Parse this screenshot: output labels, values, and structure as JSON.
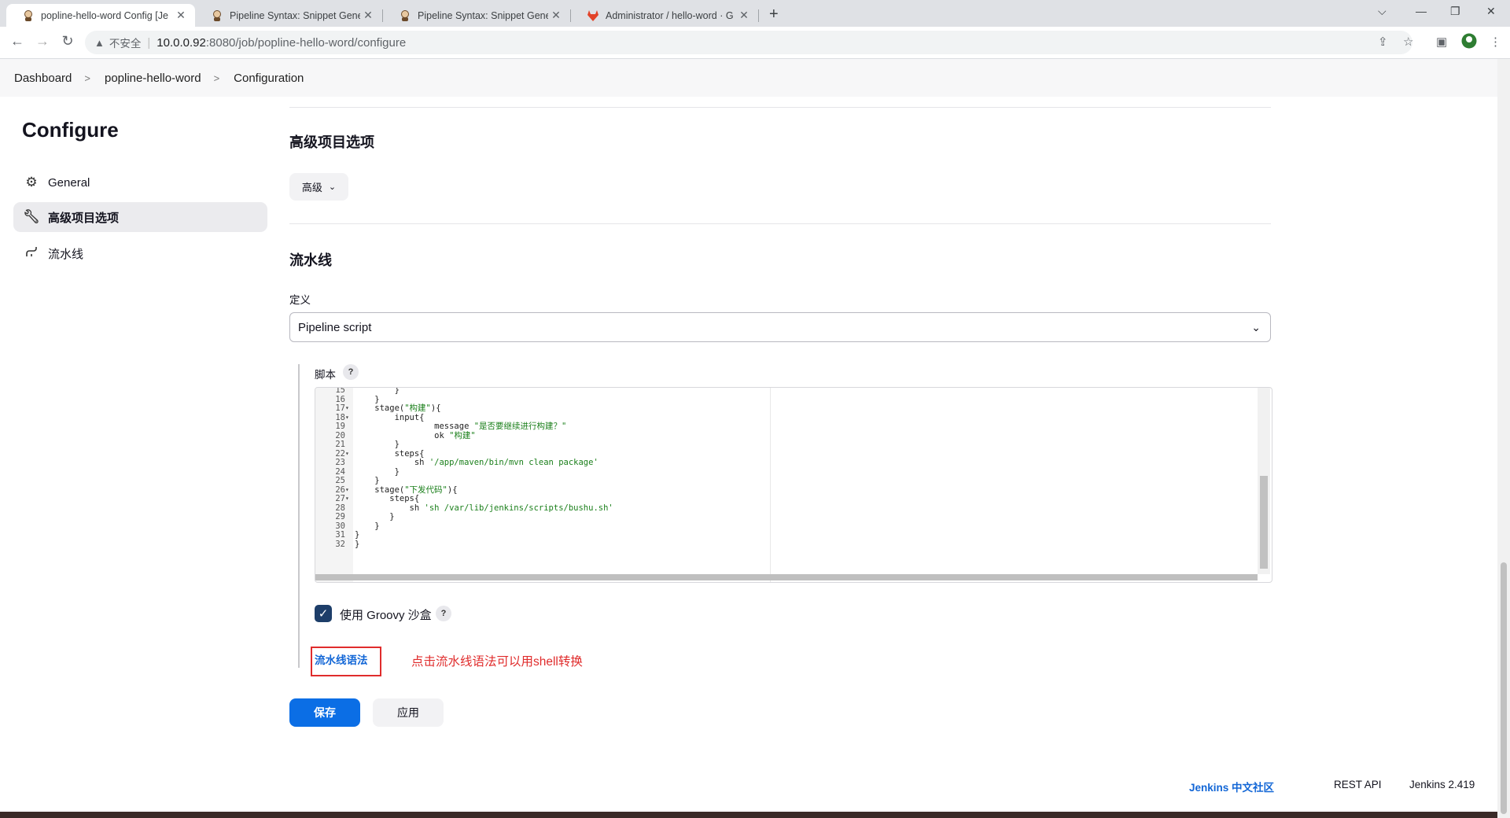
{
  "browser": {
    "tabs": [
      {
        "title": "popline-hello-word Config [Je",
        "active": true
      },
      {
        "title": "Pipeline Syntax: Snippet Gener",
        "active": false
      },
      {
        "title": "Pipeline Syntax: Snippet Gener",
        "active": false
      },
      {
        "title": "Administrator / hello-word · G",
        "active": false
      }
    ],
    "new_tab": "+",
    "window_controls": {
      "dropdown": "⌵",
      "minimize": "—",
      "restore": "❐",
      "close": "✕"
    },
    "address": {
      "warning_icon": "warning-icon",
      "insecure_label": "不安全",
      "host": "10.0.0.92",
      "path": ":8080/job/popline-hello-word/configure"
    }
  },
  "breadcrumb": [
    "Dashboard",
    "popline-hello-word",
    "Configuration"
  ],
  "sidebar": {
    "title": "Configure",
    "items": [
      {
        "label": "General",
        "icon": "gear-icon",
        "active": false
      },
      {
        "label": "高级项目选项",
        "icon": "wrench-icon",
        "active": true
      },
      {
        "label": "流水线",
        "icon": "pipeline-icon",
        "active": false
      }
    ]
  },
  "advanced": {
    "heading": "高级项目选项",
    "button_label": "高级"
  },
  "pipeline": {
    "heading": "流水线",
    "definition_label": "定义",
    "definition_value": "Pipeline script",
    "script_label": "脚本",
    "help": "?",
    "code_lines": [
      {
        "n": "15",
        "fold": "",
        "text": "        }"
      },
      {
        "n": "16",
        "fold": "",
        "text": "    }"
      },
      {
        "n": "17",
        "fold": "▾",
        "text": "    stage(\"构建\"){"
      },
      {
        "n": "18",
        "fold": "▾",
        "text": "        input{"
      },
      {
        "n": "19",
        "fold": "",
        "text": "                message \"是否要继续进行构建？\""
      },
      {
        "n": "20",
        "fold": "",
        "text": "                ok \"构建\""
      },
      {
        "n": "21",
        "fold": "",
        "text": "        }"
      },
      {
        "n": "22",
        "fold": "▾",
        "text": "        steps{"
      },
      {
        "n": "23",
        "fold": "",
        "text": "            sh '/app/maven/bin/mvn clean package'"
      },
      {
        "n": "24",
        "fold": "",
        "text": "        }"
      },
      {
        "n": "25",
        "fold": "",
        "text": "    }"
      },
      {
        "n": "26",
        "fold": "▾",
        "text": "    stage(\"下发代码\"){"
      },
      {
        "n": "27",
        "fold": "▾",
        "text": "       steps{"
      },
      {
        "n": "28",
        "fold": "",
        "text": "           sh 'sh /var/lib/jenkins/scripts/bushu.sh'"
      },
      {
        "n": "29",
        "fold": "",
        "text": "       }"
      },
      {
        "n": "30",
        "fold": "",
        "text": "    }"
      },
      {
        "n": "31",
        "fold": "",
        "text": "}"
      },
      {
        "n": "32",
        "fold": "",
        "text": "}"
      }
    ],
    "sandbox_label": "使用 Groovy 沙盒",
    "sandbox_checked": true,
    "syntax_link": "流水线语法",
    "annotation": "点击流水线语法可以用shell转换"
  },
  "actions": {
    "save": "保存",
    "apply": "应用"
  },
  "footer": {
    "community": "Jenkins 中文社区",
    "rest_api": "REST API",
    "version": "Jenkins 2.419"
  },
  "colors": {
    "primary": "#0b6ee5",
    "link": "#1266d6",
    "annotation": "#e02c2c",
    "checkbox": "#1d3e69"
  }
}
